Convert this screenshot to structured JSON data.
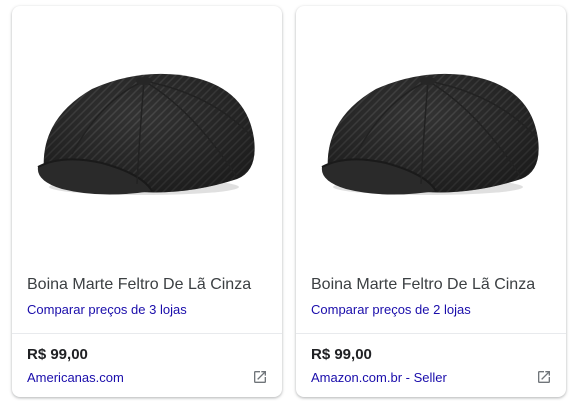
{
  "products": [
    {
      "image": "flat-cap-image",
      "title": "Boina Marte Feltro De Lã Cinza",
      "compare": "Comparar preços de 3 lojas",
      "price": "R$ 99,00",
      "store": "Americanas.com",
      "icon": "open-in-new-icon"
    },
    {
      "image": "flat-cap-image",
      "title": "Boina Marte Feltro De Lã Cinza",
      "compare": "Comparar preços de 2 lojas",
      "price": "R$ 99,00",
      "store": "Amazon.com.br - Seller",
      "icon": "open-in-new-icon"
    }
  ],
  "colors": {
    "title": "#3c4043",
    "link": "#1a0dab",
    "price": "#202124",
    "divider": "#e8eaed",
    "cap": "#2e2e2e"
  }
}
